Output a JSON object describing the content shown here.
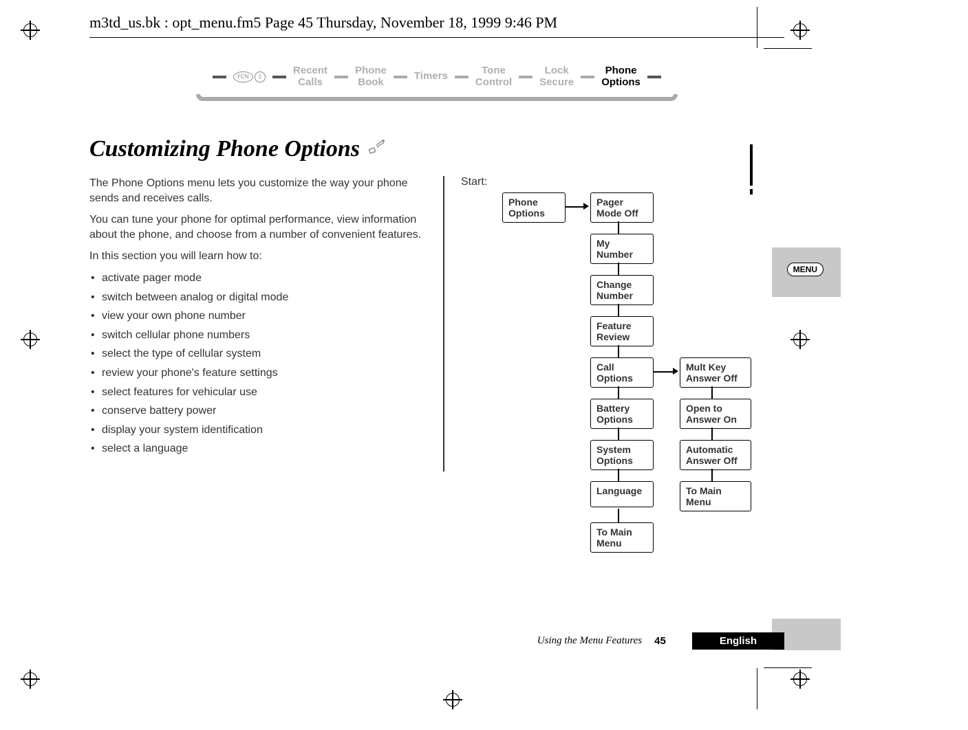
{
  "doc_header": "m3td_us.bk : opt_menu.fm5  Page 45  Thursday, November 18, 1999  9:46 PM",
  "nav": {
    "key_label_fcn": "FCN",
    "key_label_one": "1",
    "items": [
      "Recent\nCalls",
      "Phone\nBook",
      "Timers",
      "Tone\nControl",
      "Lock\nSecure",
      "Phone\nOptions"
    ]
  },
  "title": "Customizing Phone Options",
  "intro1": "The Phone Options menu lets you customize the way your phone sends and receives calls.",
  "intro2": "You can tune your phone for optimal performance, view information about the phone, and choose from a number of convenient features.",
  "intro3": "In this section you will learn how to:",
  "bullets": [
    "activate pager mode",
    "switch between analog or digital mode",
    "view your own phone number",
    "switch cellular phone numbers",
    "select the type of cellular system",
    "review your phone's feature settings",
    "select features for vehicular use",
    "conserve battery power",
    "display your system identification",
    "select a language"
  ],
  "start_label": "Start:",
  "flow": {
    "root": "Phone\nOptions",
    "col1": [
      "Pager\nMode Off",
      "My\nNumber",
      "Change\nNumber",
      "Feature\nReview",
      "Call\nOptions",
      "Battery\nOptions",
      "System\nOptions",
      "Language",
      "To Main\nMenu"
    ],
    "col2": [
      "Mult Key\nAnswer Off",
      "Open to\nAnswer On",
      "Automatic\nAnswer Off",
      "To Main\nMenu"
    ]
  },
  "footer": {
    "section": "Using the Menu Features",
    "page": "45",
    "language": "English"
  },
  "side_menu_label": "MENU"
}
